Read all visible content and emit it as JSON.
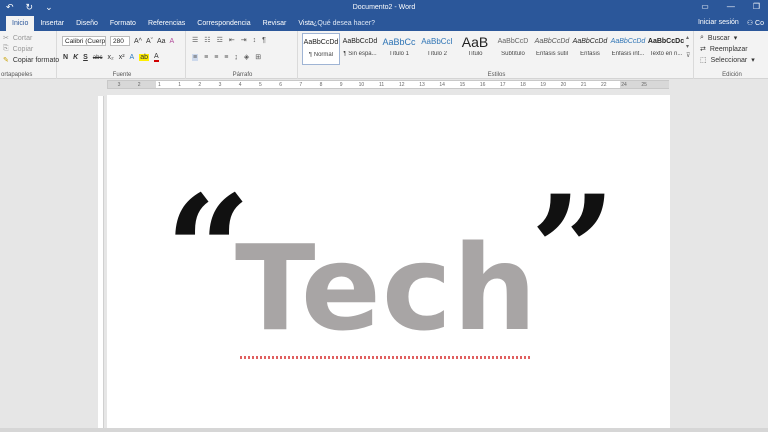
{
  "title_bar": {
    "title": "Documento2 - Word",
    "undo": "↶",
    "redo": "↻",
    "customize": "⌄",
    "window_buttons": [
      "▭",
      "—",
      "❐"
    ]
  },
  "tabs": [
    {
      "label": "Inicio",
      "active": true
    },
    {
      "label": "Insertar"
    },
    {
      "label": "Diseño"
    },
    {
      "label": "Formato"
    },
    {
      "label": "Referencias"
    },
    {
      "label": "Correspondencia"
    },
    {
      "label": "Revisar"
    },
    {
      "label": "Vista"
    }
  ],
  "tell_me": "¿Qué desea hacer?",
  "signin": "Iniciar sesión",
  "share": "Co",
  "clipboard": {
    "cut": "Cortar",
    "copy": "Copiar",
    "format_painter": "Copiar formato",
    "label": "ortapapeles"
  },
  "font": {
    "name": "Calibri (Cuerp",
    "size": "280",
    "label": "Fuente",
    "bold": "N",
    "italic": "K",
    "underline": "S",
    "strike": "abc",
    "subscript": "x₂",
    "superscript": "x²",
    "grow": "A^",
    "shrink": "Aˇ",
    "case": "Aa",
    "clear": "A",
    "text_effects": "A",
    "highlight": "ab",
    "font_color": "A"
  },
  "paragraph": {
    "label": "Párrafo",
    "show_marks": "¶"
  },
  "styles": {
    "label": "Estilos",
    "items": [
      {
        "preview": "AaBbCcDd",
        "name": "¶ Normal",
        "selected": true
      },
      {
        "preview": "AaBbCcDd",
        "name": "¶ Sin espa..."
      },
      {
        "preview": "AaBbCc",
        "name": "Título 1"
      },
      {
        "preview": "AaBbCcI",
        "name": "Título 2"
      },
      {
        "preview": "AaB",
        "name": "Título"
      },
      {
        "preview": "AaBbCcD",
        "name": "Subtítulo"
      },
      {
        "preview": "AaBbCcDd",
        "name": "Énfasis sutil"
      },
      {
        "preview": "AaBbCcDd",
        "name": "Énfasis"
      },
      {
        "preview": "AaBbCcDd",
        "name": "Énfasis int..."
      },
      {
        "preview": "AaBbCcDc",
        "name": "Texto en n..."
      }
    ]
  },
  "editing": {
    "label": "Edición",
    "find": "Buscar",
    "replace": "Reemplazar",
    "select": "Seleccionar"
  },
  "ruler_ticks": [
    "3",
    "2",
    "1",
    "1",
    "2",
    "3",
    "4",
    "5",
    "6",
    "7",
    "8",
    "9",
    "10",
    "11",
    "12",
    "13",
    "14",
    "15",
    "16",
    "17",
    "18",
    "19",
    "20",
    "21",
    "22",
    "24",
    "25"
  ],
  "document": {
    "quote_open": "“",
    "word": "Tech",
    "quote_close": "”"
  },
  "colors": {
    "accent": "#2b579a",
    "ribbon": "#f3f3f3",
    "text_gray": "#a8a5a5",
    "spell_error": "#e06060"
  }
}
